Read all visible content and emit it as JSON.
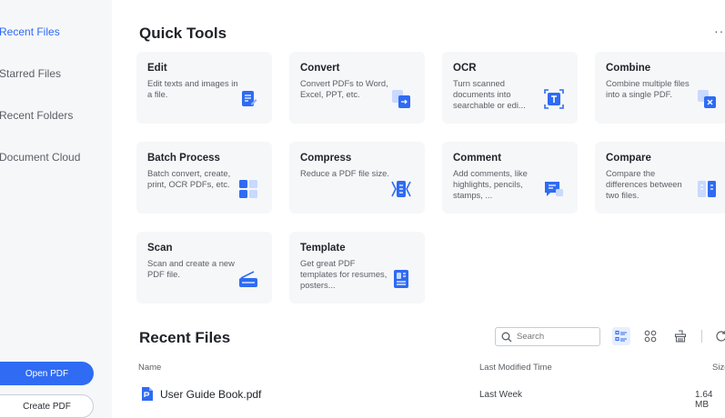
{
  "sidebar": {
    "items": [
      {
        "label": "Recent Files",
        "active": true
      },
      {
        "label": "Starred Files",
        "active": false
      },
      {
        "label": "Recent Folders",
        "active": false
      },
      {
        "label": "Document Cloud",
        "active": false
      }
    ],
    "open_pdf": "Open PDF",
    "create_pdf": "Create PDF"
  },
  "quick_tools": {
    "title": "Quick Tools",
    "more": "···",
    "cards": [
      {
        "title": "Edit",
        "desc": "Edit texts and images in a file.",
        "icon": "edit-icon"
      },
      {
        "title": "Convert",
        "desc": "Convert PDFs to Word, Excel, PPT, etc.",
        "icon": "convert-icon"
      },
      {
        "title": "OCR",
        "desc": "Turn scanned documents into searchable or edi...",
        "icon": "ocr-icon"
      },
      {
        "title": "Combine",
        "desc": "Combine multiple files into a single PDF.",
        "icon": "combine-icon"
      },
      {
        "title": "Batch Process",
        "desc": "Batch convert, create, print, OCR PDFs, etc.",
        "icon": "batch-icon"
      },
      {
        "title": "Compress",
        "desc": "Reduce a PDF file size.",
        "icon": "compress-icon"
      },
      {
        "title": "Comment",
        "desc": "Add comments, like highlights, pencils, stamps, ...",
        "icon": "comment-icon"
      },
      {
        "title": "Compare",
        "desc": "Compare the differences between two files.",
        "icon": "compare-icon"
      },
      {
        "title": "Scan",
        "desc": "Scan and create a new PDF file.",
        "icon": "scan-icon"
      },
      {
        "title": "Template",
        "desc": "Get great PDF templates for resumes, posters...",
        "icon": "template-icon"
      }
    ]
  },
  "recent_files": {
    "title": "Recent Files",
    "search_placeholder": "Search",
    "columns": {
      "name": "Name",
      "modified": "Last Modified Time",
      "size": "Size"
    },
    "rows": [
      {
        "name": "User Guide Book.pdf",
        "modified": "Last Week",
        "size": "1.64 MB"
      }
    ]
  },
  "colors": {
    "accent": "#2f6bf3",
    "card_bg": "#f6f7f9",
    "sidebar_bg": "#f6f7f9"
  }
}
